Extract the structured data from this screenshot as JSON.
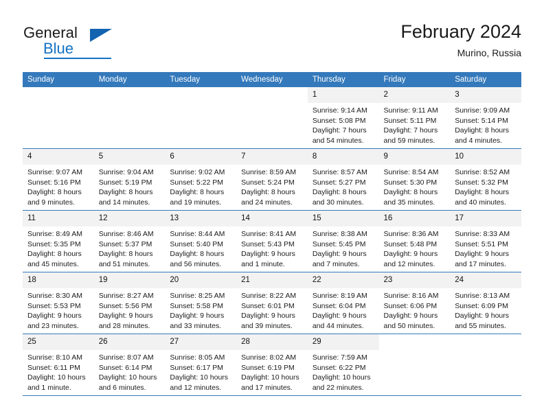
{
  "brand": {
    "name_part1": "General",
    "name_part2": "Blue",
    "triangle_icon": "triangle-icon"
  },
  "header": {
    "month_title": "February 2024",
    "location": "Murino, Russia"
  },
  "calendar": {
    "weekday_headers": [
      "Sunday",
      "Monday",
      "Tuesday",
      "Wednesday",
      "Thursday",
      "Friday",
      "Saturday"
    ],
    "weeks": [
      [
        {
          "day": "",
          "empty": true
        },
        {
          "day": "",
          "empty": true
        },
        {
          "day": "",
          "empty": true
        },
        {
          "day": "",
          "empty": true
        },
        {
          "day": "1",
          "sunrise": "Sunrise: 9:14 AM",
          "sunset": "Sunset: 5:08 PM",
          "daylight_1": "Daylight: 7 hours",
          "daylight_2": "and 54 minutes."
        },
        {
          "day": "2",
          "sunrise": "Sunrise: 9:11 AM",
          "sunset": "Sunset: 5:11 PM",
          "daylight_1": "Daylight: 7 hours",
          "daylight_2": "and 59 minutes."
        },
        {
          "day": "3",
          "sunrise": "Sunrise: 9:09 AM",
          "sunset": "Sunset: 5:14 PM",
          "daylight_1": "Daylight: 8 hours",
          "daylight_2": "and 4 minutes."
        }
      ],
      [
        {
          "day": "4",
          "sunrise": "Sunrise: 9:07 AM",
          "sunset": "Sunset: 5:16 PM",
          "daylight_1": "Daylight: 8 hours",
          "daylight_2": "and 9 minutes."
        },
        {
          "day": "5",
          "sunrise": "Sunrise: 9:04 AM",
          "sunset": "Sunset: 5:19 PM",
          "daylight_1": "Daylight: 8 hours",
          "daylight_2": "and 14 minutes."
        },
        {
          "day": "6",
          "sunrise": "Sunrise: 9:02 AM",
          "sunset": "Sunset: 5:22 PM",
          "daylight_1": "Daylight: 8 hours",
          "daylight_2": "and 19 minutes."
        },
        {
          "day": "7",
          "sunrise": "Sunrise: 8:59 AM",
          "sunset": "Sunset: 5:24 PM",
          "daylight_1": "Daylight: 8 hours",
          "daylight_2": "and 24 minutes."
        },
        {
          "day": "8",
          "sunrise": "Sunrise: 8:57 AM",
          "sunset": "Sunset: 5:27 PM",
          "daylight_1": "Daylight: 8 hours",
          "daylight_2": "and 30 minutes."
        },
        {
          "day": "9",
          "sunrise": "Sunrise: 8:54 AM",
          "sunset": "Sunset: 5:30 PM",
          "daylight_1": "Daylight: 8 hours",
          "daylight_2": "and 35 minutes."
        },
        {
          "day": "10",
          "sunrise": "Sunrise: 8:52 AM",
          "sunset": "Sunset: 5:32 PM",
          "daylight_1": "Daylight: 8 hours",
          "daylight_2": "and 40 minutes."
        }
      ],
      [
        {
          "day": "11",
          "sunrise": "Sunrise: 8:49 AM",
          "sunset": "Sunset: 5:35 PM",
          "daylight_1": "Daylight: 8 hours",
          "daylight_2": "and 45 minutes."
        },
        {
          "day": "12",
          "sunrise": "Sunrise: 8:46 AM",
          "sunset": "Sunset: 5:37 PM",
          "daylight_1": "Daylight: 8 hours",
          "daylight_2": "and 51 minutes."
        },
        {
          "day": "13",
          "sunrise": "Sunrise: 8:44 AM",
          "sunset": "Sunset: 5:40 PM",
          "daylight_1": "Daylight: 8 hours",
          "daylight_2": "and 56 minutes."
        },
        {
          "day": "14",
          "sunrise": "Sunrise: 8:41 AM",
          "sunset": "Sunset: 5:43 PM",
          "daylight_1": "Daylight: 9 hours",
          "daylight_2": "and 1 minute."
        },
        {
          "day": "15",
          "sunrise": "Sunrise: 8:38 AM",
          "sunset": "Sunset: 5:45 PM",
          "daylight_1": "Daylight: 9 hours",
          "daylight_2": "and 7 minutes."
        },
        {
          "day": "16",
          "sunrise": "Sunrise: 8:36 AM",
          "sunset": "Sunset: 5:48 PM",
          "daylight_1": "Daylight: 9 hours",
          "daylight_2": "and 12 minutes."
        },
        {
          "day": "17",
          "sunrise": "Sunrise: 8:33 AM",
          "sunset": "Sunset: 5:51 PM",
          "daylight_1": "Daylight: 9 hours",
          "daylight_2": "and 17 minutes."
        }
      ],
      [
        {
          "day": "18",
          "sunrise": "Sunrise: 8:30 AM",
          "sunset": "Sunset: 5:53 PM",
          "daylight_1": "Daylight: 9 hours",
          "daylight_2": "and 23 minutes."
        },
        {
          "day": "19",
          "sunrise": "Sunrise: 8:27 AM",
          "sunset": "Sunset: 5:56 PM",
          "daylight_1": "Daylight: 9 hours",
          "daylight_2": "and 28 minutes."
        },
        {
          "day": "20",
          "sunrise": "Sunrise: 8:25 AM",
          "sunset": "Sunset: 5:58 PM",
          "daylight_1": "Daylight: 9 hours",
          "daylight_2": "and 33 minutes."
        },
        {
          "day": "21",
          "sunrise": "Sunrise: 8:22 AM",
          "sunset": "Sunset: 6:01 PM",
          "daylight_1": "Daylight: 9 hours",
          "daylight_2": "and 39 minutes."
        },
        {
          "day": "22",
          "sunrise": "Sunrise: 8:19 AM",
          "sunset": "Sunset: 6:04 PM",
          "daylight_1": "Daylight: 9 hours",
          "daylight_2": "and 44 minutes."
        },
        {
          "day": "23",
          "sunrise": "Sunrise: 8:16 AM",
          "sunset": "Sunset: 6:06 PM",
          "daylight_1": "Daylight: 9 hours",
          "daylight_2": "and 50 minutes."
        },
        {
          "day": "24",
          "sunrise": "Sunrise: 8:13 AM",
          "sunset": "Sunset: 6:09 PM",
          "daylight_1": "Daylight: 9 hours",
          "daylight_2": "and 55 minutes."
        }
      ],
      [
        {
          "day": "25",
          "sunrise": "Sunrise: 8:10 AM",
          "sunset": "Sunset: 6:11 PM",
          "daylight_1": "Daylight: 10 hours",
          "daylight_2": "and 1 minute."
        },
        {
          "day": "26",
          "sunrise": "Sunrise: 8:07 AM",
          "sunset": "Sunset: 6:14 PM",
          "daylight_1": "Daylight: 10 hours",
          "daylight_2": "and 6 minutes."
        },
        {
          "day": "27",
          "sunrise": "Sunrise: 8:05 AM",
          "sunset": "Sunset: 6:17 PM",
          "daylight_1": "Daylight: 10 hours",
          "daylight_2": "and 12 minutes."
        },
        {
          "day": "28",
          "sunrise": "Sunrise: 8:02 AM",
          "sunset": "Sunset: 6:19 PM",
          "daylight_1": "Daylight: 10 hours",
          "daylight_2": "and 17 minutes."
        },
        {
          "day": "29",
          "sunrise": "Sunrise: 7:59 AM",
          "sunset": "Sunset: 6:22 PM",
          "daylight_1": "Daylight: 10 hours",
          "daylight_2": "and 22 minutes."
        },
        {
          "day": "",
          "empty": true
        },
        {
          "day": "",
          "empty": true
        }
      ]
    ]
  },
  "colors": {
    "header_blue": "#3479bb",
    "brand_blue": "#1271c4",
    "daynum_band": "#f2f2f2"
  }
}
